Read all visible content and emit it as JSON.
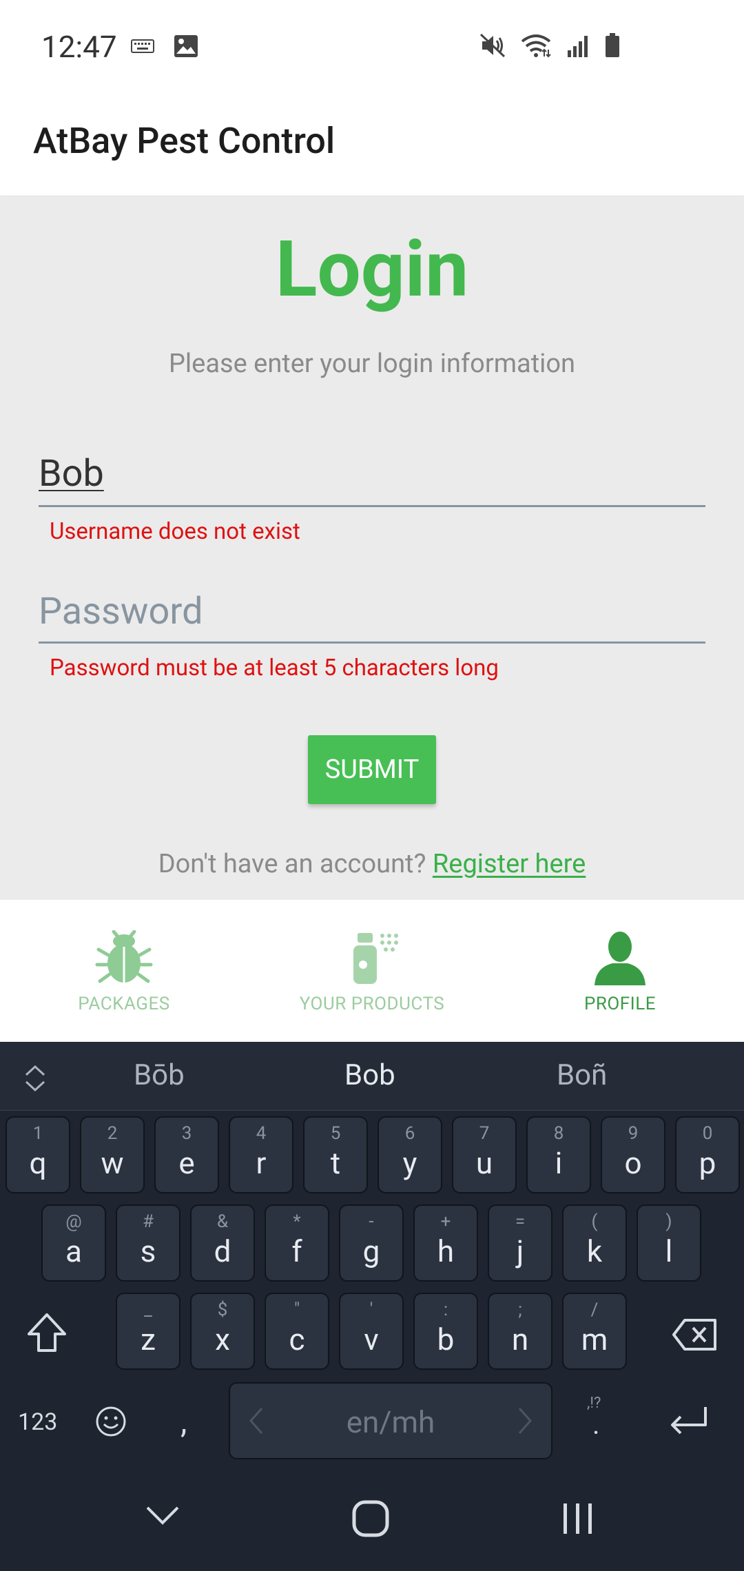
{
  "status_bar": {
    "time": "12:47"
  },
  "app_bar": {
    "title": "AtBay Pest Control"
  },
  "login": {
    "title": "Login",
    "subtitle": "Please enter your login information",
    "username_value": "Bob",
    "username_error": "Username does not exist",
    "password_placeholder": "Password",
    "password_error": "Password must be at least 5 characters long",
    "submit_label": "SUBMIT",
    "register_prompt": "Don't have an account?",
    "register_link": "Register here"
  },
  "tabs": [
    {
      "label": "PACKAGES",
      "icon": "bug-icon",
      "active": false
    },
    {
      "label": "YOUR PRODUCTS",
      "icon": "spray-bottle-icon",
      "active": false
    },
    {
      "label": "PROFILE",
      "icon": "person-icon",
      "active": true
    }
  ],
  "keyboard": {
    "suggestions": [
      "Bōb",
      "Bob",
      "Boñ"
    ],
    "row1": [
      {
        "ch": "q",
        "hint": "1"
      },
      {
        "ch": "w",
        "hint": "2"
      },
      {
        "ch": "e",
        "hint": "3"
      },
      {
        "ch": "r",
        "hint": "4"
      },
      {
        "ch": "t",
        "hint": "5"
      },
      {
        "ch": "y",
        "hint": "6"
      },
      {
        "ch": "u",
        "hint": "7"
      },
      {
        "ch": "i",
        "hint": "8"
      },
      {
        "ch": "o",
        "hint": "9"
      },
      {
        "ch": "p",
        "hint": "0"
      }
    ],
    "row2": [
      {
        "ch": "a",
        "hint": "@"
      },
      {
        "ch": "s",
        "hint": "#"
      },
      {
        "ch": "d",
        "hint": "&"
      },
      {
        "ch": "f",
        "hint": "*"
      },
      {
        "ch": "g",
        "hint": "-"
      },
      {
        "ch": "h",
        "hint": "+"
      },
      {
        "ch": "j",
        "hint": "="
      },
      {
        "ch": "k",
        "hint": "("
      },
      {
        "ch": "l",
        "hint": ")"
      }
    ],
    "row3": [
      {
        "ch": "z",
        "hint": "_"
      },
      {
        "ch": "x",
        "hint": "$"
      },
      {
        "ch": "c",
        "hint": "\""
      },
      {
        "ch": "v",
        "hint": "'"
      },
      {
        "ch": "b",
        "hint": ":"
      },
      {
        "ch": "n",
        "hint": ";"
      },
      {
        "ch": "m",
        "hint": "/"
      }
    ],
    "numbers_label": "123",
    "comma_label": ",",
    "space_label": "en/mh",
    "punct_hint": ",!?",
    "period_label": "."
  },
  "colors": {
    "accent": "#43b84e",
    "error": "#e01010",
    "keyboard_bg": "#1e2430"
  }
}
